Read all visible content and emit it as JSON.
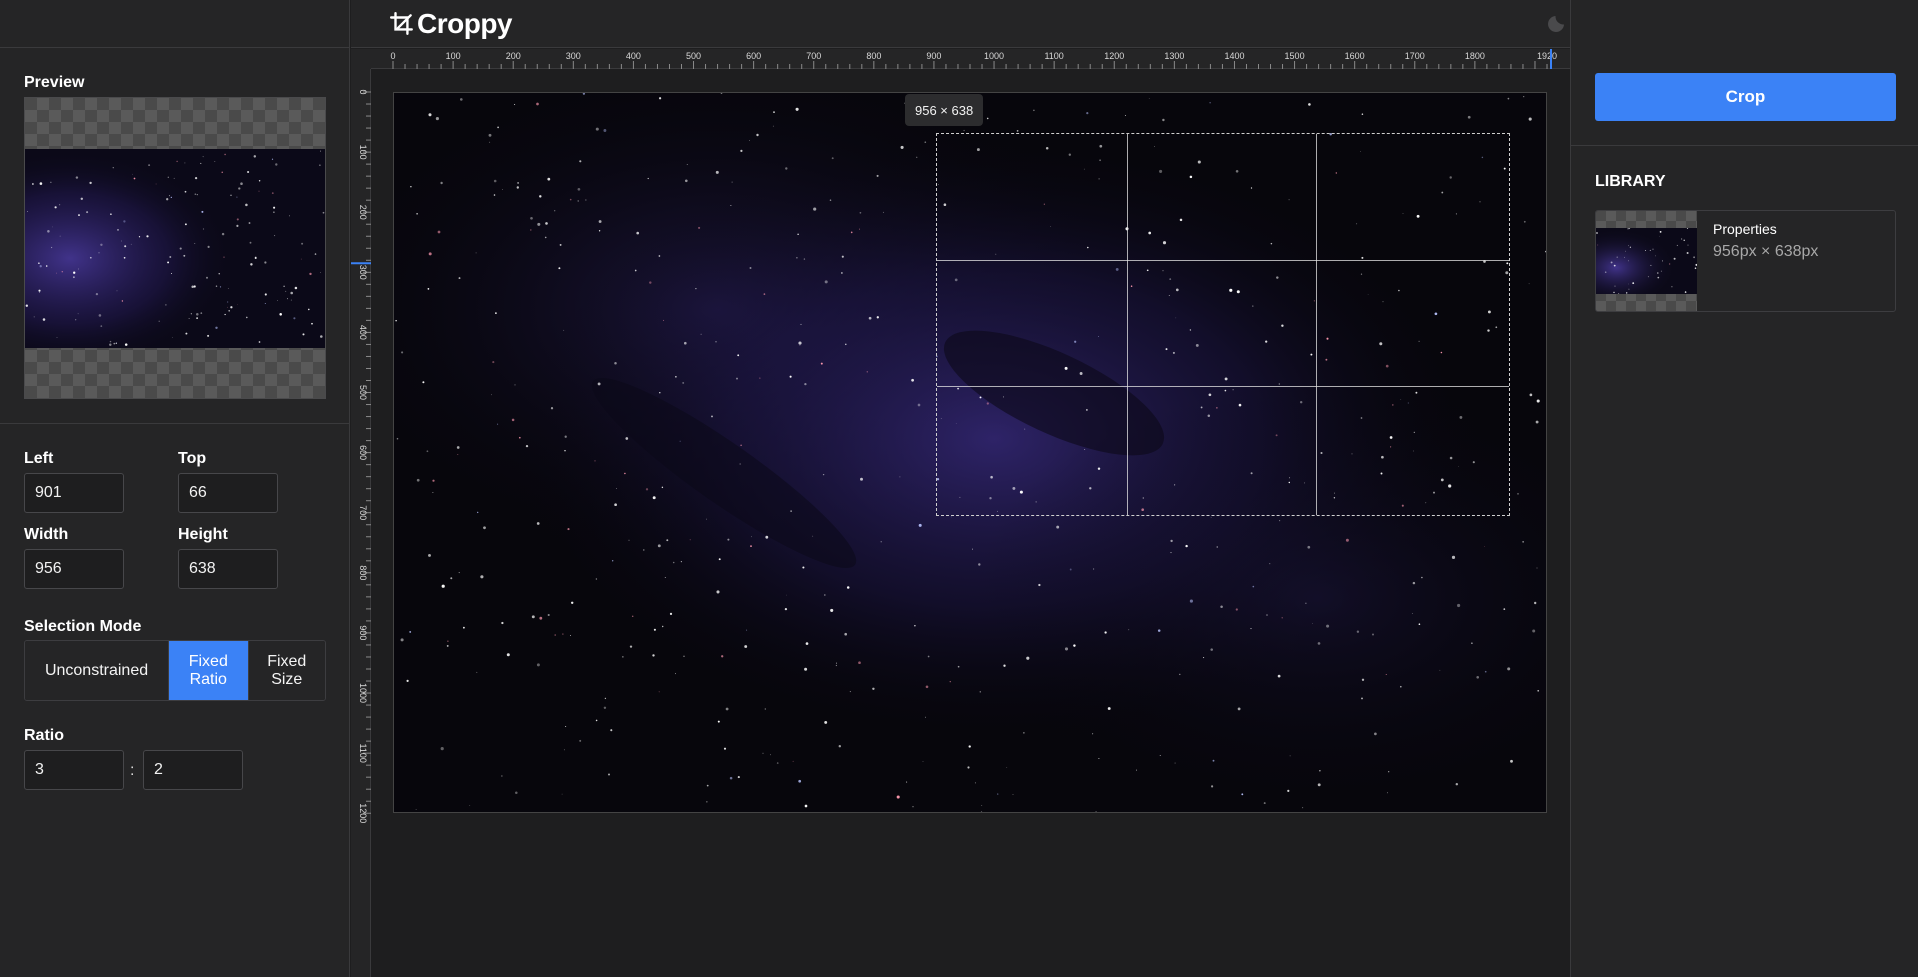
{
  "app": {
    "name": "Croppy",
    "logo_icon": "crop-icon",
    "theme_toggle_icon": "moon-icon"
  },
  "preview": {
    "label": "Preview"
  },
  "fields": {
    "left": {
      "label": "Left",
      "value": "901"
    },
    "top": {
      "label": "Top",
      "value": "66"
    },
    "width": {
      "label": "Width",
      "value": "956"
    },
    "height": {
      "label": "Height",
      "value": "638"
    }
  },
  "selection_mode": {
    "label": "Selection Mode",
    "options": [
      {
        "line1": "Unconstrained",
        "line2": "",
        "active": false
      },
      {
        "line1": "Fixed",
        "line2": "Ratio",
        "active": true
      },
      {
        "line1": "Fixed",
        "line2": "Size",
        "active": false
      }
    ]
  },
  "ratio": {
    "label": "Ratio",
    "a": "3",
    "separator": ":",
    "b": "2"
  },
  "rulers": {
    "horizontal_ticks": [
      "0",
      "100",
      "200",
      "300",
      "400",
      "500",
      "600",
      "700",
      "800",
      "900",
      "1000",
      "1100",
      "1200",
      "1300",
      "1400",
      "1500",
      "1600",
      "1700",
      "1800",
      "1920"
    ],
    "vertical_ticks": [
      "0",
      "100",
      "200",
      "300",
      "400",
      "500",
      "600",
      "700",
      "800",
      "900",
      "1000",
      "1100",
      "1200"
    ]
  },
  "canvas": {
    "size_tooltip": "956 × 638"
  },
  "right": {
    "crop_label": "Crop",
    "library_title": "LIBRARY",
    "library_items": [
      {
        "name": "Properties",
        "size": "956px × 638px"
      }
    ]
  },
  "colors": {
    "accent": "#3b82f6",
    "panel": "#252526",
    "background": "#1e1e1f"
  }
}
